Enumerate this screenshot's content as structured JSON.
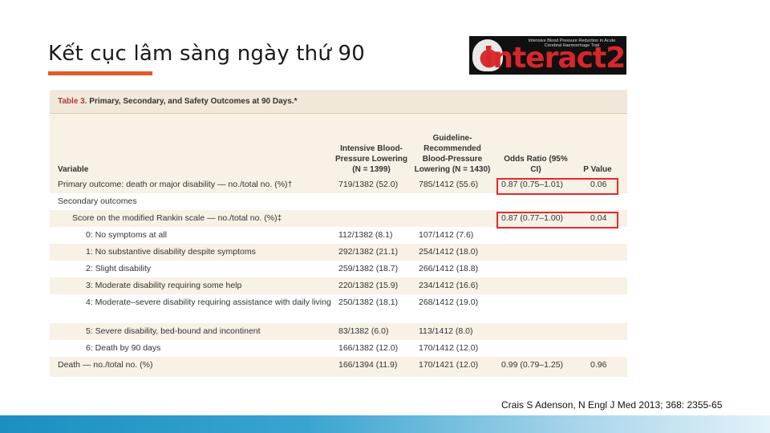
{
  "slide": {
    "title": "Kết cục lâm sàng ngày thứ 90",
    "citation": "Crais S Adenson, N Engl J Med 2013; 368: 2355-65",
    "accent_color": "#e05a2b",
    "footer_color": "#1c8fc0"
  },
  "logo": {
    "tagline": "Intensive Blood Pressure Reduction in Acute Cerebral Haemorrhage Trial",
    "wordmark": "interact2",
    "icon": "brain-head-icon"
  },
  "table": {
    "caption_label": "Table 3.",
    "caption_text": " Primary, Secondary, and Safety Outcomes at 90 Days.*",
    "headers": {
      "variable": "Variable",
      "intensive": "Intensive Blood-Pressure Lowering (N = 1399)",
      "guideline": "Guideline-Recommended Blood-Pressure Lowering (N = 1430)",
      "odds_ratio": "Odds Ratio (95% CI)",
      "p_value": "P Value"
    },
    "rows": [
      {
        "variable": "Primary outcome: death or major disability — no./total no. (%)†",
        "intensive": "719/1382 (52.0)",
        "guideline": "785/1412 (55.6)",
        "odds_ratio": "0.87 (0.75–1.01)",
        "p_value": "0.06"
      },
      {
        "variable": "Secondary outcomes",
        "intensive": "",
        "guideline": "",
        "odds_ratio": "",
        "p_value": ""
      },
      {
        "variable": "Score on the modified Rankin scale — no./total no. (%)‡",
        "intensive": "",
        "guideline": "",
        "odds_ratio": "0.87 (0.77–1.00)",
        "p_value": "0.04"
      },
      {
        "variable": "0: No symptoms at all",
        "intensive": "112/1382 (8.1)",
        "guideline": "107/1412 (7.6)",
        "odds_ratio": "",
        "p_value": ""
      },
      {
        "variable": "1: No substantive disability despite symptoms",
        "intensive": "292/1382 (21.1)",
        "guideline": "254/1412 (18.0)",
        "odds_ratio": "",
        "p_value": ""
      },
      {
        "variable": "2: Slight disability",
        "intensive": "259/1382 (18.7)",
        "guideline": "266/1412 (18.8)",
        "odds_ratio": "",
        "p_value": ""
      },
      {
        "variable": "3: Moderate disability requiring some help",
        "intensive": "220/1382 (15.9)",
        "guideline": "234/1412 (16.6)",
        "odds_ratio": "",
        "p_value": ""
      },
      {
        "variable": "4: Moderate–severe disability requiring assistance with daily living",
        "intensive": "250/1382 (18.1)",
        "guideline": "268/1412 (19.0)",
        "odds_ratio": "",
        "p_value": ""
      },
      {
        "variable": "5: Severe disability, bed-bound and incontinent",
        "intensive": "83/1382 (6.0)",
        "guideline": "113/1412 (8.0)",
        "odds_ratio": "",
        "p_value": ""
      },
      {
        "variable": "6: Death by 90 days",
        "intensive": "166/1382 (12.0)",
        "guideline": "170/1412 (12.0)",
        "odds_ratio": "",
        "p_value": ""
      },
      {
        "variable": "Death — no./total no. (%)",
        "intensive": "166/1394 (11.9)",
        "guideline": "170/1421 (12.0)",
        "odds_ratio": "0.99 (0.79–1.25)",
        "p_value": "0.96"
      }
    ],
    "highlight_color": "#e52a2a"
  }
}
